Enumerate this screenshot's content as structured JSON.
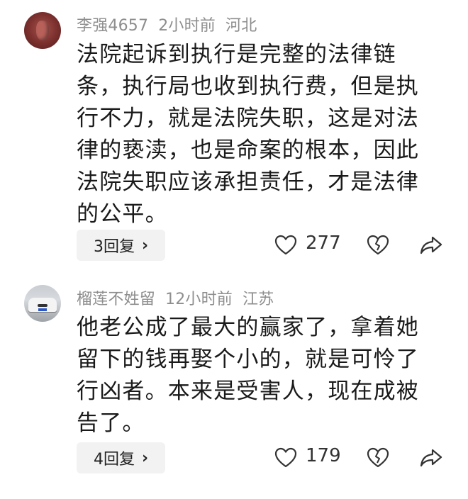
{
  "comments": [
    {
      "username": "李强4657",
      "time": "2小时前",
      "location": "河北",
      "text": "法院起诉到执行是完整的法律链条，执行局也收到执行费，但是执行不力，就是法院失职，这是对法律的亵渎，也是命案的根本，因此法院失职应该承担责任，才是法律的公平。",
      "replies": "3回复",
      "likes": "277"
    },
    {
      "username": "榴莲不姓留",
      "time": "12小时前",
      "location": "江苏",
      "text": "他老公成了最大的赢家了，拿着她留下的钱再娶个小的，就是可怜了行凶者。本来是受害人，现在成被告了。",
      "replies": "4回复",
      "likes": "179"
    }
  ],
  "icons": {
    "like": "heart-outline-icon",
    "dislike": "broken-heart-icon",
    "share": "share-arrow-icon",
    "chevron": "chevron-right-icon"
  },
  "colors": {
    "meta": "#8e8e8e",
    "text": "#1a1a1a",
    "reply_bg": "#f2f2f2"
  }
}
